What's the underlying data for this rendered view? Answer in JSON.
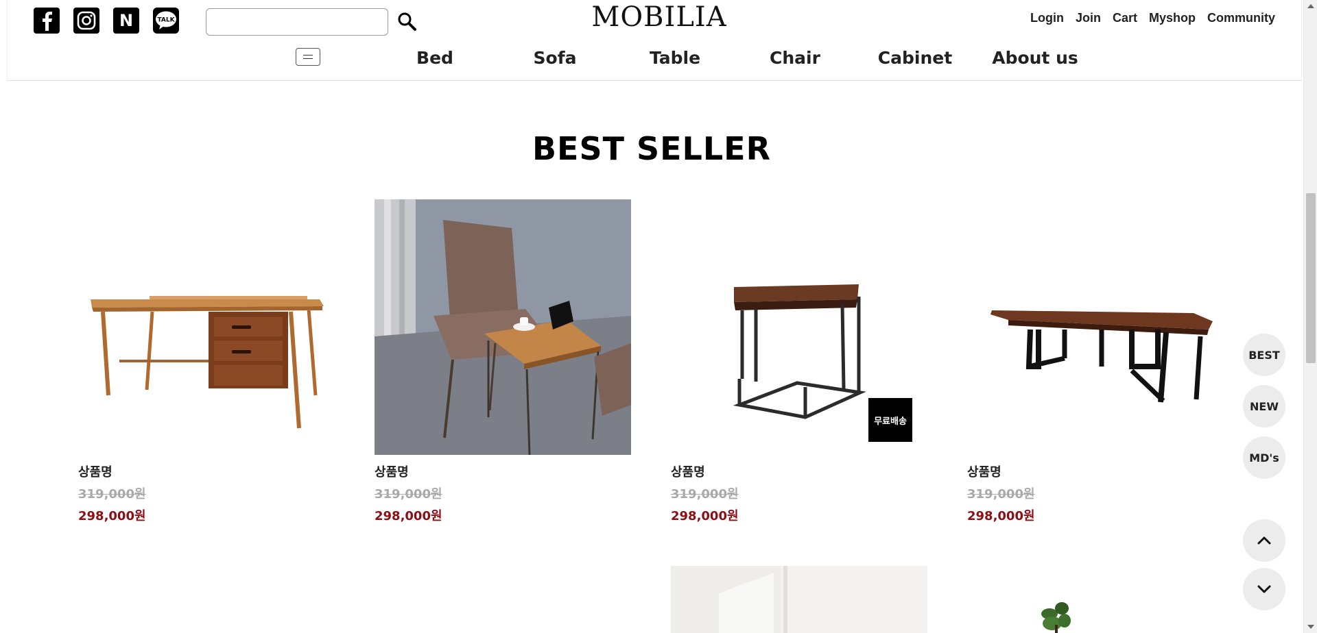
{
  "header": {
    "social": [
      {
        "name": "facebook-icon",
        "glyph": "f"
      },
      {
        "name": "instagram-icon",
        "glyph": ""
      },
      {
        "name": "naver-icon",
        "glyph": "N"
      },
      {
        "name": "kakao-talk-icon",
        "glyph": "TALK"
      }
    ],
    "search": {
      "placeholder": "",
      "value": ""
    },
    "logo": "MOBILIA",
    "links": [
      "Login",
      "Join",
      "Cart",
      "Myshop",
      "Community"
    ],
    "nav": [
      "Bed",
      "Sofa",
      "Table",
      "Chair",
      "Cabinet",
      "About us"
    ]
  },
  "section": {
    "title": "BEST SELLER"
  },
  "products": [
    {
      "name": "상품명",
      "original_price": "319,000원",
      "sale_price": "298,000원"
    },
    {
      "name": "상품명",
      "original_price": "319,000원",
      "sale_price": "298,000원"
    },
    {
      "name": "상품명",
      "original_price": "319,000원",
      "sale_price": "298,000원",
      "badge": "무료배송"
    },
    {
      "name": "상품명",
      "original_price": "319,000원",
      "sale_price": "298,000원"
    }
  ],
  "quick_nav": {
    "best": "BEST",
    "new": "NEW",
    "md": "MD's"
  },
  "colors": {
    "sale": "#8b0f12",
    "strike": "#a9a9a9",
    "quick_bg": "#ececec"
  }
}
